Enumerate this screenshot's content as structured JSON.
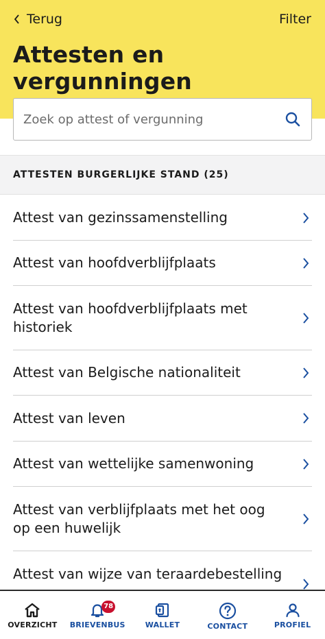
{
  "nav": {
    "back_label": "Terug",
    "filter_label": "Filter"
  },
  "page": {
    "title": "Attesten en vergunningen"
  },
  "search": {
    "placeholder": "Zoek op attest of vergunning"
  },
  "section": {
    "title": "ATTESTEN BURGERLIJKE STAND (25)"
  },
  "items": [
    {
      "label": "Attest van gezinssamenstelling"
    },
    {
      "label": "Attest van hoofdverblijfplaats"
    },
    {
      "label": "Attest van hoofdverblijfplaats met historiek"
    },
    {
      "label": "Attest van Belgische nationaliteit"
    },
    {
      "label": "Attest van leven"
    },
    {
      "label": "Attest van wettelijke samenwoning"
    },
    {
      "label": "Attest van verblijfplaats met het oog op een huwelijk"
    },
    {
      "label": "Attest van wijze van teraardebestelling"
    }
  ],
  "tabbar": {
    "overzicht": {
      "label": "OVERZICHT",
      "icon": "home-icon"
    },
    "brievenbus": {
      "label": "BRIEVENBUS",
      "icon": "bell-icon",
      "badge": "78"
    },
    "wallet": {
      "label": "WALLET",
      "icon": "wallet-icon"
    },
    "contact": {
      "label": "CONTACT",
      "icon": "help-icon"
    },
    "profiel": {
      "label": "PROFIEL",
      "icon": "user-icon"
    }
  },
  "colors": {
    "header_bg": "#f8e45c",
    "accent_blue": "#1a4fa0",
    "active_tab": "#1b1b1b",
    "badge": "#c8102e"
  }
}
